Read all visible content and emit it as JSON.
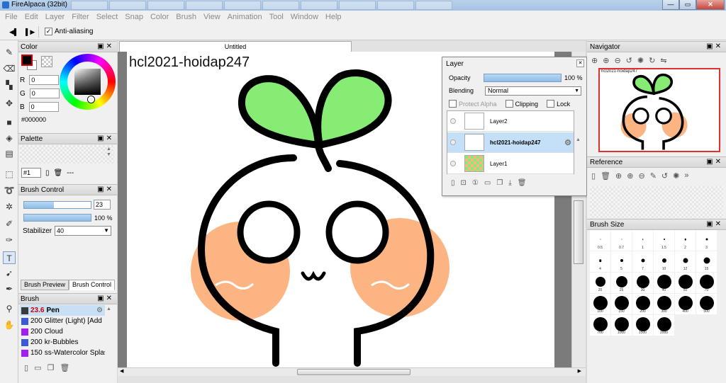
{
  "window": {
    "title": "FireAlpaca (32bit)",
    "background_tabs": [
      "",
      "",
      "",
      "",
      "",
      "",
      "",
      "",
      "",
      ""
    ],
    "controls": [
      "—",
      "▭",
      "✕"
    ]
  },
  "menu": [
    "File",
    "Edit",
    "Layer",
    "Filter",
    "Select",
    "Snap",
    "Color",
    "Brush",
    "View",
    "Animation",
    "Tool",
    "Window",
    "Help"
  ],
  "toolbar": {
    "antialiasing_label": "Anti-aliasing",
    "antialiasing_checked": "✓"
  },
  "tools": [
    "pen",
    "eraser",
    "dot",
    "move",
    "fill",
    "bucket",
    "gradient",
    "select",
    "lasso",
    "magic-wand",
    "select-pen",
    "select-eraser",
    "text",
    "operation",
    "brush",
    "eyedropper",
    "hand"
  ],
  "color_panel": {
    "title": "Color",
    "r_label": "R",
    "g_label": "G",
    "b_label": "B",
    "r_value": "0",
    "g_value": "0",
    "b_value": "0",
    "hex": "#000000",
    "foreground": "#000000",
    "background": "#ffffff"
  },
  "palette_panel": {
    "title": "Palette",
    "selected": "#1",
    "dash": "---"
  },
  "brush_control": {
    "title": "Brush Control",
    "size_value": "23",
    "size_fraction": 0.45,
    "opacity_value": "100 %",
    "opacity_fraction": 1.0,
    "stabilizer_label": "Stabilizer",
    "stabilizer_value": "40"
  },
  "tabs": {
    "brush_preview": "Brush Preview",
    "brush_control": "Brush Control"
  },
  "brush_panel": {
    "title": "Brush",
    "items": [
      {
        "size": "23.6",
        "name": "Pen",
        "color": "#3a3a3a",
        "selected": true
      },
      {
        "size": "200",
        "name": "Glitter (Light) [Add",
        "color": "#3b5bd6"
      },
      {
        "size": "200",
        "name": "Cloud",
        "color": "#a020f0"
      },
      {
        "size": "200",
        "name": "kr-Bubbles",
        "color": "#3b5bd6"
      },
      {
        "size": "150",
        "name": "ss-Watercolor Splas",
        "color": "#a020f0"
      }
    ]
  },
  "document": {
    "tab_title": "Untitled",
    "watermark": "hcl2021-hoidap247"
  },
  "layer_panel": {
    "title": "Layer",
    "opacity_label": "Opacity",
    "opacity_value": "100 %",
    "blending_label": "Blending",
    "blending_value": "Normal",
    "protect_alpha": "Protect Alpha",
    "clipping": "Clipping",
    "lock": "Lock",
    "layers": [
      {
        "name": "Layer2",
        "selected": false
      },
      {
        "name": "hcl2021-hoidap247",
        "selected": true
      },
      {
        "name": "Layer1",
        "selected": false
      }
    ]
  },
  "navigator": {
    "title": "Navigator",
    "thumb_label": "hcl2021-hoidap247"
  },
  "reference": {
    "title": "Reference"
  },
  "brush_size": {
    "title": "Brush Size",
    "sizes": [
      "0.5",
      "0.7",
      "1",
      "1.5",
      "2",
      "3",
      "4",
      "5",
      "7",
      "10",
      "12",
      "15",
      "20",
      "25",
      "30",
      "40",
      "50",
      "70",
      "100",
      "150",
      "200",
      "300",
      "400",
      "500",
      "700",
      "1000",
      "1500",
      "2000"
    ]
  },
  "colors": {
    "leaf": "#87ec74",
    "cheek": "#fbb482",
    "outline": "#000000",
    "selection": "#c3e0f8"
  }
}
